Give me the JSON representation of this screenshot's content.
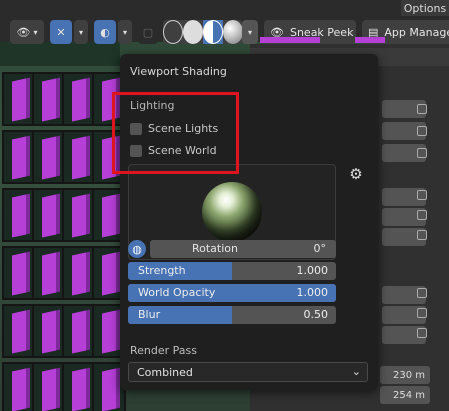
{
  "header": {
    "options_label": "Options",
    "sneak_peek_label": "Sneak Peek",
    "app_manage_label": "App Manage"
  },
  "popover": {
    "title": "Viewport Shading",
    "lighting_label": "Lighting",
    "scene_lights_label": "Scene Lights",
    "scene_world_label": "Scene World",
    "rotation": {
      "label": "Rotation",
      "value": "0°"
    },
    "strength": {
      "label": "Strength",
      "value": "1.000",
      "fill": 0.5
    },
    "world_opacity": {
      "label": "World Opacity",
      "value": "1.000",
      "fill": 1.0
    },
    "blur": {
      "label": "Blur",
      "value": "0.50",
      "fill": 0.5
    },
    "render_pass_label": "Render Pass",
    "render_pass_value": "Combined"
  },
  "dimensions": {
    "x": "230 m",
    "y": "254 m"
  },
  "colors": {
    "accent": "#4772b3",
    "highlight": "#e0141e",
    "magenta": "#b63fd8"
  }
}
